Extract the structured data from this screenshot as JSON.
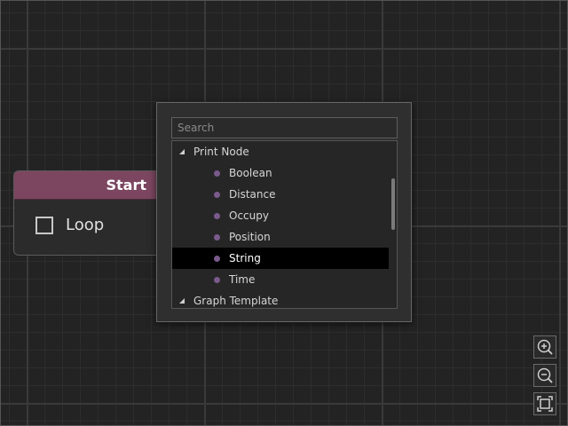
{
  "node": {
    "title": "Start",
    "checkbox_label": "Loop",
    "header_color": "#7c4660"
  },
  "search": {
    "placeholder": "Search",
    "value": ""
  },
  "tree": {
    "groups": [
      {
        "label": "Print Node",
        "expanded": true,
        "items": [
          {
            "label": "Boolean"
          },
          {
            "label": "Distance"
          },
          {
            "label": "Occupy"
          },
          {
            "label": "Position"
          },
          {
            "label": "String",
            "selected": true
          },
          {
            "label": "Time"
          }
        ]
      },
      {
        "label": "Graph Template",
        "expanded": true,
        "items": []
      }
    ]
  },
  "controls": [
    {
      "icon": "zoom-in-icon"
    },
    {
      "icon": "zoom-out-icon"
    },
    {
      "icon": "fit-view-icon"
    }
  ]
}
